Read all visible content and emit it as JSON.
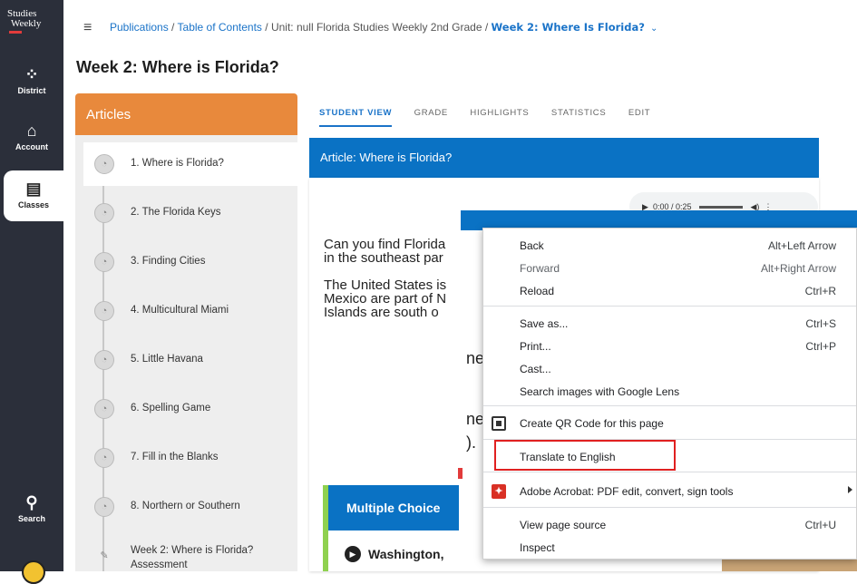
{
  "rail": {
    "logo_line1": "Studies",
    "logo_line2": "Weekly",
    "items": [
      {
        "label": "District",
        "icon": "district-icon"
      },
      {
        "label": "Account",
        "icon": "account-icon"
      },
      {
        "label": "Classes",
        "icon": "classes-icon"
      },
      {
        "label": "Search",
        "icon": "search-icon"
      }
    ]
  },
  "breadcrumb": {
    "publications": "Publications",
    "sep1": " / ",
    "toc": "Table of Contents",
    "sep2": " / ",
    "unit": "Unit: null Florida Studies Weekly 2nd Grade",
    "sep3": " / ",
    "current": "Week 2: Where Is Florida?"
  },
  "page_title": "Week 2: Where is Florida?",
  "articles": {
    "header": "Articles",
    "items": [
      "1. Where is Florida?",
      "2. The Florida Keys",
      "3. Finding Cities",
      "4. Multicultural Miami",
      "5. Little Havana",
      "6. Spelling Game",
      "7. Fill in the Blanks",
      "8. Northern or Southern",
      "Week 2: Where is Florida?",
      "Assessment"
    ]
  },
  "tabs": [
    "STUDENT VIEW",
    "GRADE",
    "HIGHLIGHTS",
    "STATISTICS",
    "EDIT"
  ],
  "article": {
    "header": "Article: Where is Florida?",
    "audio_time": "0:00 / 0:25",
    "p1_line1": "Can you find Florida",
    "p1_line2": "in the southeast par",
    "p2_line1": "The United States is",
    "p2_line2": "Mexico are part of N",
    "p2_line3": "Islands are south o",
    "frag1": "ne",
    "frag2": "ne",
    "frag3": ").",
    "mc_header": "Multiple Choice",
    "mc_option": "Washington,"
  },
  "context_menu": {
    "items": [
      {
        "label": "Back",
        "shortcut": "Alt+Left Arrow"
      },
      {
        "label": "Forward",
        "shortcut": "Alt+Right Arrow"
      },
      {
        "label": "Reload",
        "shortcut": "Ctrl+R"
      },
      {
        "label": "Save as...",
        "shortcut": "Ctrl+S"
      },
      {
        "label": "Print...",
        "shortcut": "Ctrl+P"
      },
      {
        "label": "Cast...",
        "shortcut": ""
      },
      {
        "label": "Search images with Google Lens",
        "shortcut": ""
      },
      {
        "label": "Create QR Code for this page",
        "shortcut": ""
      },
      {
        "label": "Translate to English",
        "shortcut": ""
      },
      {
        "label": "Adobe Acrobat: PDF edit, convert, sign tools",
        "shortcut": ""
      },
      {
        "label": "View page source",
        "shortcut": "Ctrl+U"
      },
      {
        "label": "Inspect",
        "shortcut": ""
      }
    ]
  },
  "colors": {
    "rail": "#2b2f3a",
    "accent_blue": "#0a72c4",
    "articles_orange": "#e8893c",
    "highlight_red": "#e02020"
  }
}
